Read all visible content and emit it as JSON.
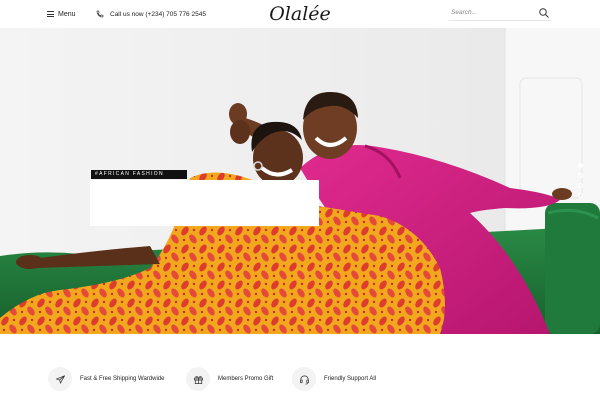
{
  "header": {
    "menu_label": "Menu",
    "call_label": "Call us now (+234) 705 776 2545",
    "logo_text": "Olalée",
    "search_placeholder": "Search...",
    "icons": [
      "menu-icon",
      "phone-icon",
      "search-icon"
    ]
  },
  "hero": {
    "badge": "#AFRICAN FASHION",
    "slider_dots_count": 4,
    "active_slide": 1
  },
  "features": [
    {
      "icon": "plane-icon",
      "label": "Fast & Free Shipping Wardwide"
    },
    {
      "icon": "gift-icon",
      "label": "Members Promo Gift"
    },
    {
      "icon": "headset-icon",
      "label": "Friendly Support All"
    }
  ],
  "colors": {
    "magenta_dress": "#d21f84",
    "print_orange": "#f0a41e",
    "print_red": "#de3c2f",
    "sofa_green": "#1f7a3c",
    "wall": "#f1f1f1"
  }
}
